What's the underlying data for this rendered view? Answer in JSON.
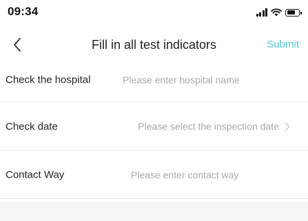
{
  "status_bar": {
    "time": "09:34"
  },
  "nav": {
    "title": "Fill in all test indicators",
    "submit_label": "Submit",
    "back_icon": "chevron-left-icon"
  },
  "form": {
    "hospital": {
      "label": "Check the hospital",
      "placeholder": "Please enter hospital name"
    },
    "date": {
      "label": "Check date",
      "placeholder": "Please select the inspection date"
    },
    "contact": {
      "label": "Contact Way",
      "placeholder": "Please enter contact way"
    }
  },
  "colors": {
    "accent": "#56c6d2",
    "placeholder": "#a9a9a9",
    "divider": "#ececec",
    "footer_bg": "#f5f5f6"
  }
}
